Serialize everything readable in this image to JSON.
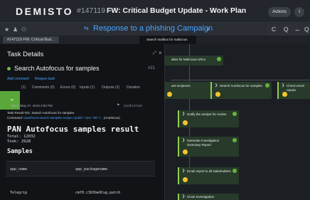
{
  "header": {
    "logo": "DEMISTO",
    "incident_id": "#147119",
    "incident_title": "FW: Critical Budget Update - Work Plan",
    "actions_label": "Actions",
    "info_label": "i"
  },
  "playbook": {
    "name": "Response to a phishing Campaign",
    "tooltip": "Search mailbox for malicious URLs"
  },
  "tab_chip": "#147119 FW: Critical Bud...",
  "task_details": {
    "title": "Task Details",
    "task_name": "Search Autofocus for samples",
    "task_number": "#21",
    "add_comment": "Add comment",
    "reopen_task": "Reopen task",
    "tabs": [
      {
        "label": "(1)"
      },
      {
        "label": "Comments (0)"
      },
      {
        "label": "Errors (0)"
      },
      {
        "label": "Inputs (1)"
      },
      {
        "label": "Outputs (2)"
      },
      {
        "label": "Duration"
      }
    ],
    "entry_date": "DBot, May 27, 2019 3:50 PM",
    "entry_right": "(21@147119",
    "task_result": "Task Result #21: Search Autofocus for samples",
    "command_prefix": "Command:",
    "command_value": "!autofocus-search-samples scope=\"public\" size=\"50\" f...",
    "command_suffix": "(Autofocus)",
    "result_title": "PAN Autofocus samples result",
    "total": "Total: 12032",
    "took": "Took: 2928",
    "samples_title": "Samples",
    "columns": [
      "app_name",
      "app_packagename"
    ],
    "row": [
      "Telegrip",
      "cmf0.c3b5bw9Cug.patch"
    ]
  },
  "nodes": [
    {
      "label": "alies for Malicious URLs"
    },
    {
      "label": "ant recipients"
    },
    {
      "label": "Search Autofocus for samples"
    },
    {
      "label": "Check email reputa"
    },
    {
      "label": "Notify the analyst for review"
    },
    {
      "label": "Generate Investigation Summary Report"
    },
    {
      "label": "Email report to all stakeholders"
    },
    {
      "label": "Close Investigation"
    }
  ],
  "toolbar": {
    "collapse": "C",
    "zoom": "Q",
    "fit": "↔",
    "search": "Q"
  },
  "colors": {
    "accent": "#4aa3ff",
    "node_green": "#8ecf4c",
    "done_green": "#67b33f",
    "badge_yellow": "#f5c42c"
  }
}
